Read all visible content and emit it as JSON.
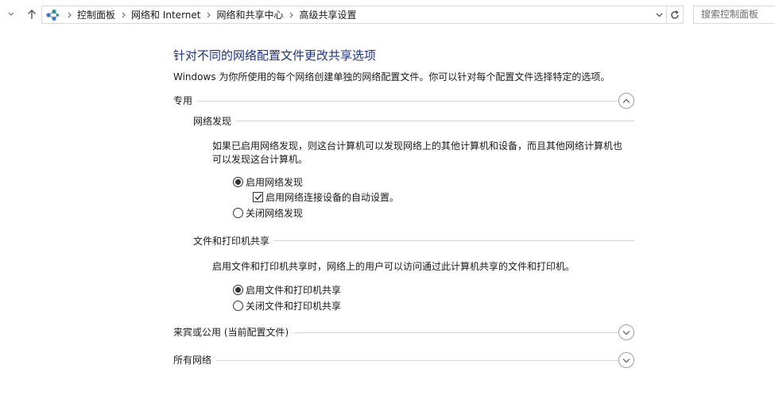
{
  "address_bar": {
    "breadcrumbs": [
      "控制面板",
      "网络和 Internet",
      "网络和共享中心",
      "高级共享设置"
    ],
    "search_placeholder": "搜索控制面板"
  },
  "page": {
    "heading": "针对不同的网络配置文件更改共享选项",
    "intro": "Windows 为你所使用的每个网络创建单独的网络配置文件。你可以针对每个配置文件选择特定的选项。"
  },
  "sections": {
    "private": {
      "title": "专用",
      "network_discovery": {
        "title": "网络发现",
        "description_line1": "如果已启用网络发现，则这台计算机可以发现网络上的其他计算机和设备，而且其他网络计算机也",
        "description_line2": "可以发现这台计算机。",
        "enable_label": "启用网络发现",
        "auto_setup_label": "启用网络连接设备的自动设置。",
        "disable_label": "关闭网络发现",
        "selected": "enable",
        "auto_setup_checked": true
      },
      "file_printer_sharing": {
        "title": "文件和打印机共享",
        "description": "启用文件和打印机共享时，网络上的用户可以访问通过此计算机共享的文件和打印机。",
        "enable_label": "启用文件和打印机共享",
        "disable_label": "关闭文件和打印机共享",
        "selected": "enable"
      }
    },
    "guest_public": {
      "title": "来宾或公用 (当前配置文件)"
    },
    "all_networks": {
      "title": "所有网络"
    }
  },
  "colors": {
    "heading": "#1e3287",
    "divider": "#d6d6d6"
  }
}
